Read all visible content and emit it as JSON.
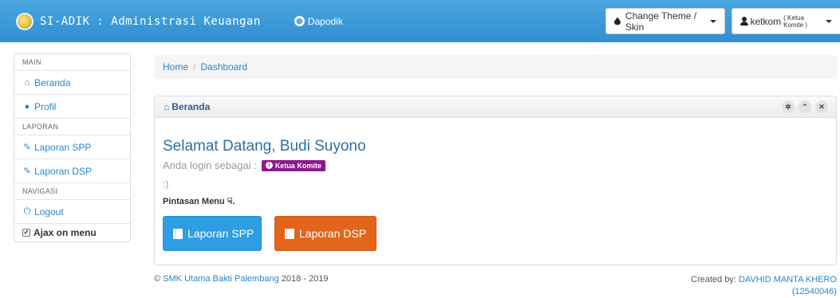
{
  "navbar": {
    "title": "SI-ADIK : Administrasi Keuangan",
    "dapodik_label": "Dapodik",
    "theme_button": "Change Theme / Skin",
    "user_name": "ketkom",
    "user_role": "( Ketua Komite )"
  },
  "sidebar": {
    "section_main": "MAIN",
    "beranda": "Beranda",
    "profil": "Profil",
    "section_laporan": "LAPORAN",
    "laporan_spp": "Laporan SPP",
    "laporan_dsp": "Laporan DSP",
    "section_navigasi": "NAVIGASI",
    "logout": "Logout",
    "ajax_label": "Ajax on menu"
  },
  "breadcrumb": {
    "home": "Home",
    "separator": "/",
    "current": "Dashboard"
  },
  "panel": {
    "title": "Beranda",
    "welcome": "Selamat Datang, Budi Suyono",
    "login_as": "Anda login sebagai :",
    "role_badge": "Ketua Komite",
    "smile": ":)",
    "shortcut_label": "Pintasan Menu",
    "shortcut_icon": "☟.",
    "button_spp": "Laporan SPP",
    "button_dsp": "Laporan DSP"
  },
  "footer": {
    "copyright_symbol": "©",
    "school": "SMK Utama Bakti Palembang",
    "years": "2018 - 2019",
    "created_by": "Created by:",
    "author": "DAVHID MANTA KHERO",
    "author_id": "(12540046)"
  },
  "colors": {
    "navbar": "#3a9ad9",
    "link": "#2a86c9",
    "badge": "#8b1a8b",
    "btn_spp": "#2e9ee3",
    "btn_dsp": "#e2651b"
  }
}
